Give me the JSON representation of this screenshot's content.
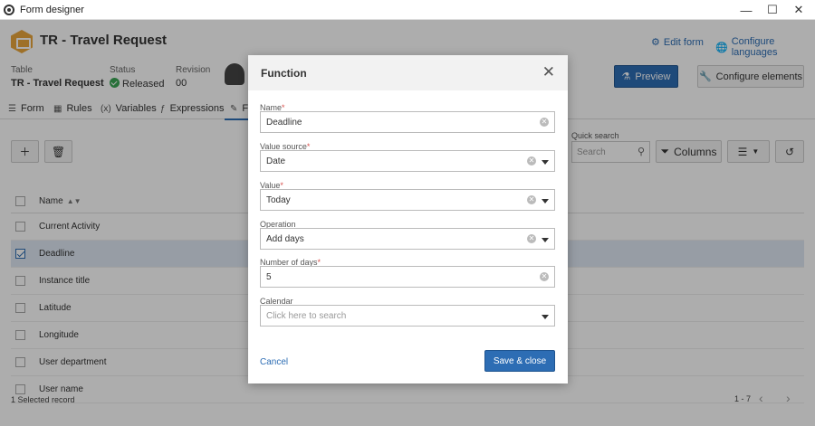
{
  "window": {
    "title": "Form designer"
  },
  "header": {
    "title": "TR - Travel Request",
    "edit_form": "Edit form",
    "configure_languages": "Configure languages",
    "table_label": "Table",
    "table_value": "TR - Travel Request",
    "status_label": "Status",
    "status_value": "Released",
    "revision_label": "Revision",
    "revision_value": "00",
    "preview": "Preview",
    "configure_elements": "Configure elements"
  },
  "tabs": [
    {
      "label": "Form"
    },
    {
      "label": "Rules"
    },
    {
      "label": "Variables"
    },
    {
      "label": "Expressions"
    },
    {
      "label": "F"
    }
  ],
  "toolbar": {
    "quick_search_label": "Quick search",
    "search_placeholder": "Search",
    "columns": "Columns"
  },
  "grid": {
    "column_name": "Name",
    "rows": [
      {
        "name": "Current Activity",
        "checked": false
      },
      {
        "name": "Deadline",
        "checked": true
      },
      {
        "name": "Instance title",
        "checked": false
      },
      {
        "name": "Latitude",
        "checked": false
      },
      {
        "name": "Longitude",
        "checked": false
      },
      {
        "name": "User department",
        "checked": false
      },
      {
        "name": "User name",
        "checked": false
      }
    ],
    "footer_selected": "1 Selected record",
    "footer_range": "1 - 7"
  },
  "modal": {
    "title": "Function",
    "fields": {
      "name": {
        "label": "Name",
        "value": "Deadline"
      },
      "value_source": {
        "label": "Value source",
        "value": "Date"
      },
      "value": {
        "label": "Value",
        "value": "Today"
      },
      "operation": {
        "label": "Operation",
        "value": "Add days"
      },
      "number_of_days": {
        "label": "Number of days",
        "value": "5"
      },
      "calendar": {
        "label": "Calendar",
        "placeholder": "Click here to search"
      }
    },
    "cancel": "Cancel",
    "save_close": "Save & close"
  },
  "colors": {
    "accent": "#2d6db4",
    "overlay": "rgba(0,0,0,0.32)",
    "required": "#d9534f"
  }
}
